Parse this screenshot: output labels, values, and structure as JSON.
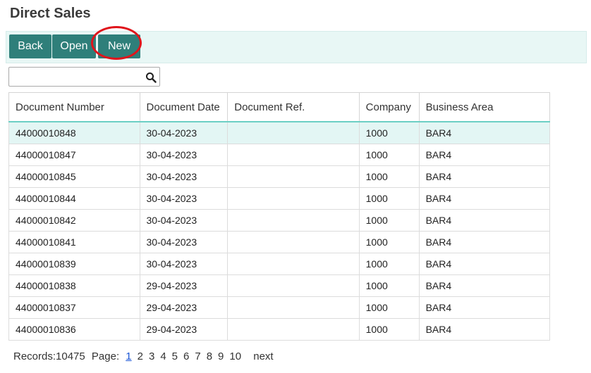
{
  "page": {
    "title": "Direct Sales"
  },
  "toolbar": {
    "back_label": "Back",
    "open_label": "Open",
    "new_label": "New"
  },
  "search": {
    "value": "",
    "placeholder": "",
    "icon": "search-icon"
  },
  "table": {
    "columns": [
      "Document Number",
      "Document Date",
      "Document Ref.",
      "Company",
      "Business Area"
    ],
    "rows": [
      [
        "44000010848",
        "30-04-2023",
        "",
        "1000",
        "BAR4"
      ],
      [
        "44000010847",
        "30-04-2023",
        "",
        "1000",
        "BAR4"
      ],
      [
        "44000010845",
        "30-04-2023",
        "",
        "1000",
        "BAR4"
      ],
      [
        "44000010844",
        "30-04-2023",
        "",
        "1000",
        "BAR4"
      ],
      [
        "44000010842",
        "30-04-2023",
        "",
        "1000",
        "BAR4"
      ],
      [
        "44000010841",
        "30-04-2023",
        "",
        "1000",
        "BAR4"
      ],
      [
        "44000010839",
        "30-04-2023",
        "",
        "1000",
        "BAR4"
      ],
      [
        "44000010838",
        "29-04-2023",
        "",
        "1000",
        "BAR4"
      ],
      [
        "44000010837",
        "29-04-2023",
        "",
        "1000",
        "BAR4"
      ],
      [
        "44000010836",
        "29-04-2023",
        "",
        "1000",
        "BAR4"
      ]
    ],
    "selected_row": 0
  },
  "pager": {
    "records_text": "Records:10475",
    "page_label": "Page:",
    "pages": [
      "1",
      "2",
      "3",
      "4",
      "5",
      "6",
      "7",
      "8",
      "9",
      "10"
    ],
    "current_page": "1",
    "next_label": "next"
  },
  "colors": {
    "accent": "#2f7f7a",
    "toolbar_bg": "#e8f7f5",
    "highlight_ring": "#e0141b",
    "selected_row": "#e3f6f4"
  }
}
